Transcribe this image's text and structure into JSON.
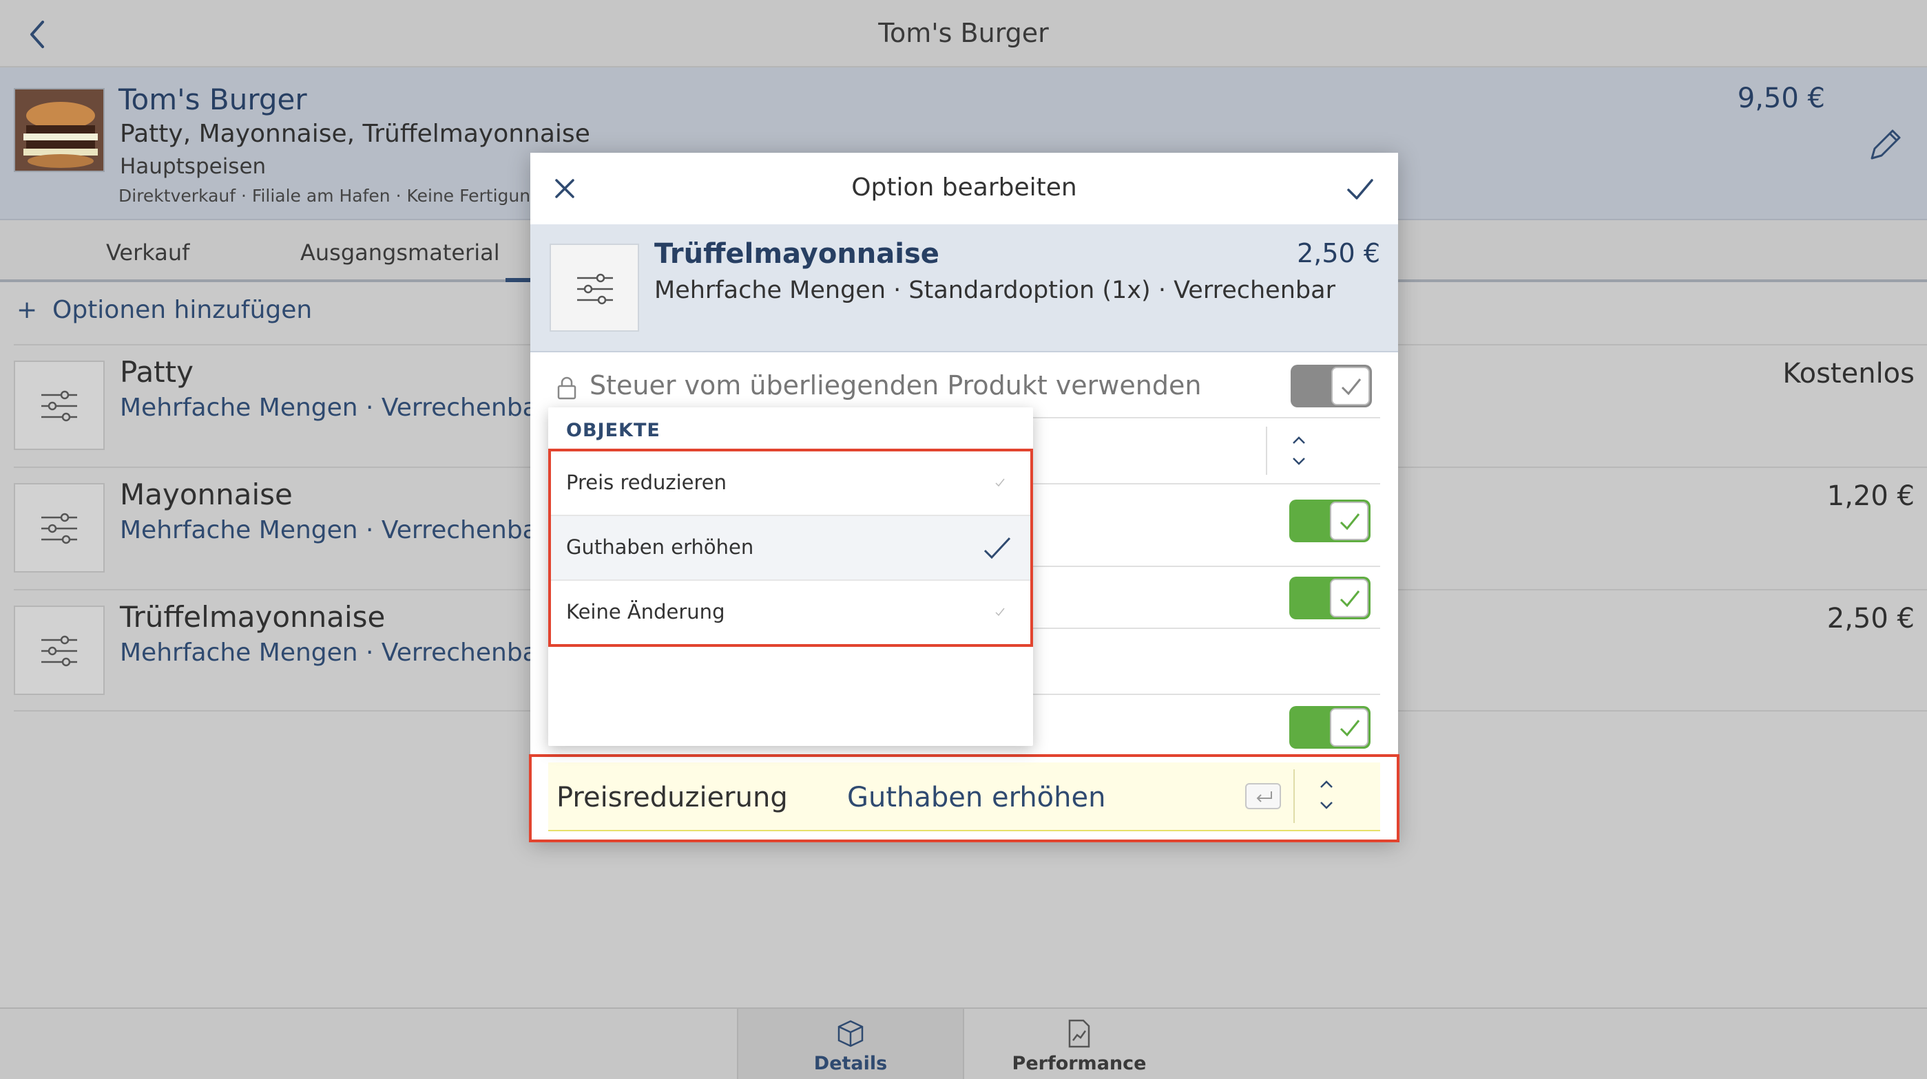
{
  "nav": {
    "title": "Tom's Burger"
  },
  "product": {
    "name": "Tom's Burger",
    "ingredients": "Patty, Mayonnaise, Trüffelmayonnaise",
    "category": "Hauptspeisen",
    "meta": "Direktverkauf · Filiale am Hafen · Keine Fertigung",
    "price": "9,50 €"
  },
  "tabs": {
    "verkauf": "Verkauf",
    "ausgangsmaterial": "Ausgangsmaterial"
  },
  "add_options": "Optionen hinzufügen",
  "options": [
    {
      "name": "Patty",
      "sub": "Mehrfache Mengen · Verrechenbar",
      "price": "Kostenlos"
    },
    {
      "name": "Mayonnaise",
      "sub": "Mehrfache Mengen · Verrechenbar",
      "price": "1,20 €"
    },
    {
      "name": "Trüffelmayonnaise",
      "sub": "Mehrfache Mengen · Verrechenbar",
      "price": "2,50 €"
    }
  ],
  "bottom_tabs": {
    "details": "Details",
    "performance": "Performance"
  },
  "modal": {
    "title": "Option bearbeiten",
    "option_name": "Trüffelmayonnaise",
    "option_sub": "Mehrfache Mengen · Standardoption (1x) · Verrechenbar",
    "option_price": "2,50 €",
    "tax_label": "Steuer vom überliegenden Produkt verwenden",
    "price_reduction_label": "Preisreduzierung",
    "price_reduction_value": "Guthaben erhöhen"
  },
  "dropdown": {
    "header": "OBJEKTE",
    "items": [
      {
        "label": "Preis reduzieren",
        "selected": false
      },
      {
        "label": "Guthaben erhöhen",
        "selected": true
      },
      {
        "label": "Keine Änderung",
        "selected": false
      }
    ]
  },
  "colors": {
    "accent": "#2f4a70",
    "toggle_on": "#5fad41",
    "highlight": "#e2442f"
  }
}
